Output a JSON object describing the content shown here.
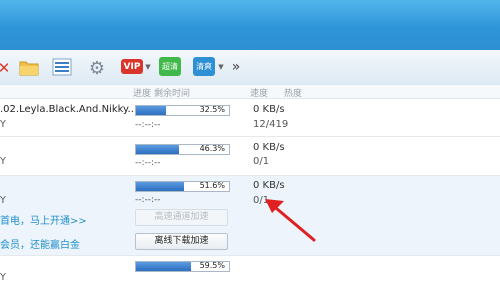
{
  "toolbar": {
    "vip_label": "VIP",
    "green_label": "超清",
    "blue_label": "清爽",
    "more_label": "»"
  },
  "header": {
    "progress": "进度",
    "remaining": "剩余时间",
    "speed": "速度",
    "heat": "热度"
  },
  "tasks": [
    {
      "name": ".02.Leyla.Black.And.Nikky....",
      "sub": "Y",
      "progress": 0.325,
      "percent": "32.5%",
      "remaining": "--:--:--",
      "speed": "0 KB/s",
      "count": "12/419"
    },
    {
      "name": "",
      "sub": "Y",
      "progress": 0.463,
      "percent": "46.3%",
      "remaining": "--:--:--",
      "speed": "0 KB/s",
      "count": "0/1"
    },
    {
      "name": "",
      "sub": "Y",
      "progress": 0.516,
      "percent": "51.6%",
      "remaining": "--:--:--",
      "speed": "0 KB/s",
      "count": "0/1",
      "promo1": "首电，马上开通>>",
      "promo2": "会员，还能赢白金",
      "btn_high": "高速通道加速",
      "btn_offline": "离线下载加速"
    },
    {
      "name": "",
      "sub": "Y",
      "progress": 0.595,
      "percent": "59.5%"
    }
  ],
  "colors": {
    "titlebar": "#2f96d9",
    "progress_fill": "#2e6fc0",
    "promo_text": "#1f8fcb",
    "annotation_arrow": "#e02020"
  },
  "icons": {
    "stop": "stop-icon",
    "folder": "folder-icon",
    "list": "list-icon",
    "settings": "gear-icon",
    "more": "chevron-double-right-icon"
  }
}
